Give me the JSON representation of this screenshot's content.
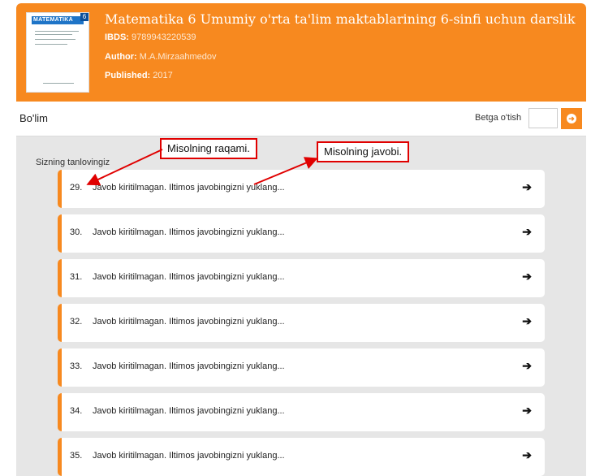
{
  "book": {
    "title": "Matematika 6 Umumiy o'rta ta'lim maktablarining 6-sinfi uchun darslik",
    "cover_brand": "MATEMATIKA",
    "cover_number": "6",
    "ibds_label": "IBDS:",
    "ibds_value": "9789943220539",
    "author_label": "Author:",
    "author_value": "M.A.Mirzaahmedov",
    "published_label": "Published:",
    "published_value": "2017"
  },
  "section_bar": {
    "title": "Bo'lim",
    "goto_label": "Betga o'tish",
    "goto_value": ""
  },
  "choices_label": "Sizning tanlovingiz",
  "items": [
    {
      "num": "29.",
      "text": "Javob kiritilmagan. Iltimos javobingizni yuklang..."
    },
    {
      "num": "30.",
      "text": "Javob kiritilmagan. Iltimos javobingizni yuklang..."
    },
    {
      "num": "31.",
      "text": "Javob kiritilmagan. Iltimos javobingizni yuklang..."
    },
    {
      "num": "32.",
      "text": "Javob kiritilmagan. Iltimos javobingizni yuklang..."
    },
    {
      "num": "33.",
      "text": "Javob kiritilmagan. Iltimos javobingizni yuklang..."
    },
    {
      "num": "34.",
      "text": "Javob kiritilmagan. Iltimos javobingizni yuklang..."
    },
    {
      "num": "35.",
      "text": "Javob kiritilmagan. Iltimos javobingizni yuklang..."
    }
  ],
  "annotations": {
    "number_callout": "Misolning raqami.",
    "answer_callout": "Misolning javobi."
  },
  "icons": {
    "item_arrow": "arrow-right-icon",
    "goto": "arrow-circle-right-icon"
  },
  "colors": {
    "accent": "#f7891f",
    "callout_border": "#e00000",
    "background": "#e6e6e6"
  }
}
